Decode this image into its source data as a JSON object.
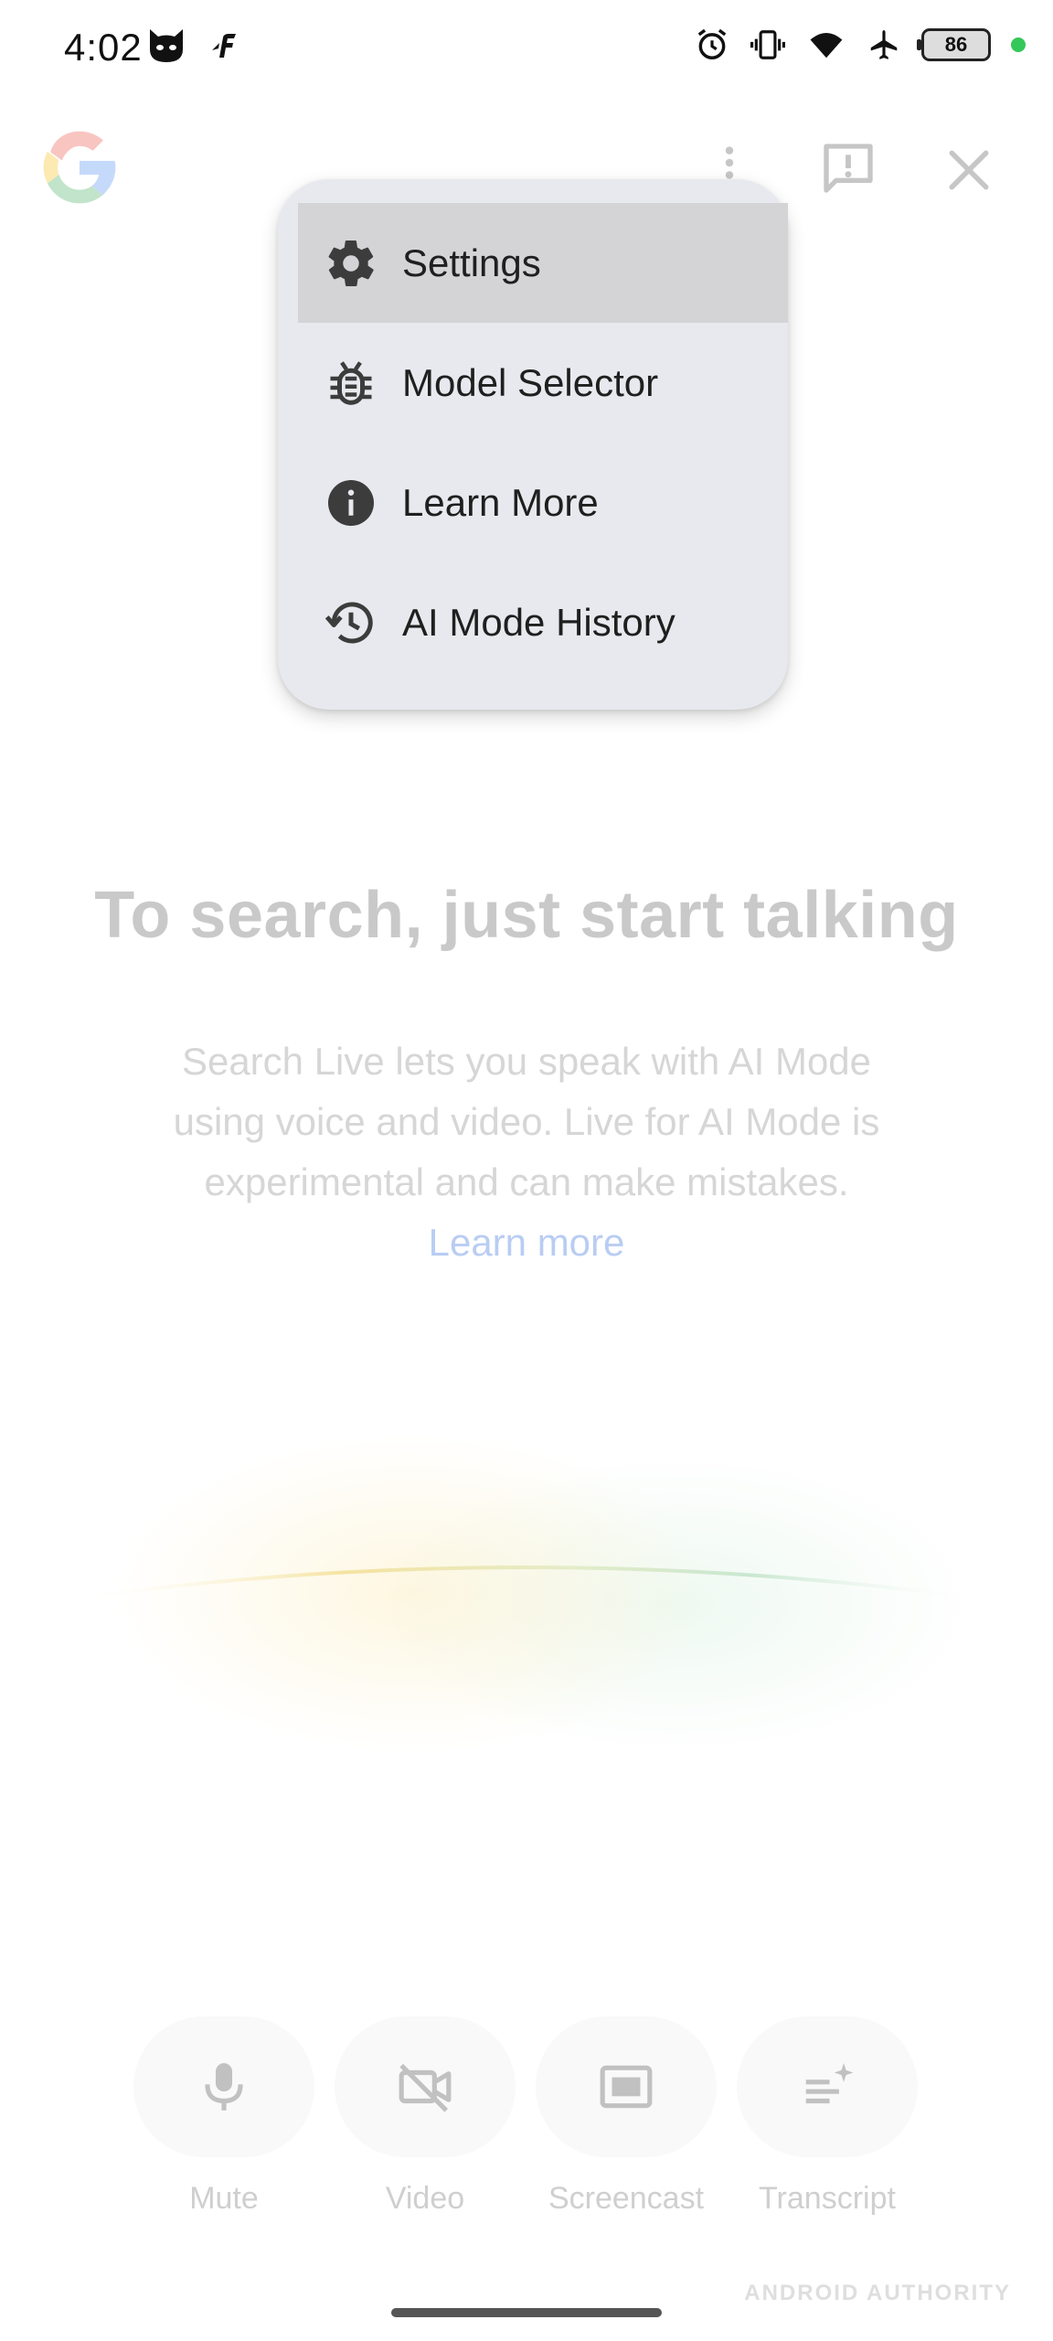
{
  "status_bar": {
    "time": "4:02",
    "battery_level": "86",
    "left_icons": [
      "cat-app-icon",
      "app-f-icon"
    ],
    "right_icons": [
      "alarm-icon",
      "vibrate-icon",
      "wifi-icon",
      "airplane-mode-icon",
      "battery-icon"
    ]
  },
  "header": {
    "icons": [
      "google-logo",
      "more-vert-icon",
      "feedback-icon",
      "close-icon"
    ]
  },
  "menu": {
    "items": [
      {
        "label": "Settings",
        "icon": "gear-icon",
        "selected": true
      },
      {
        "label": "Model Selector",
        "icon": "bug-icon",
        "selected": false
      },
      {
        "label": "Learn More",
        "icon": "info-icon",
        "selected": false
      },
      {
        "label": "AI Mode History",
        "icon": "history-icon",
        "selected": false
      }
    ]
  },
  "main": {
    "title": "To search, just start talking",
    "description": "Search Live lets you speak with AI Mode using voice and video. Live for AI Mode is experimental and can make mistakes.",
    "learn_more": "Learn more"
  },
  "controls": [
    {
      "label": "Mute",
      "icon": "mic-icon"
    },
    {
      "label": "Video",
      "icon": "video-off-icon"
    },
    {
      "label": "Screencast",
      "icon": "screencast-icon"
    },
    {
      "label": "Transcript",
      "icon": "transcript-icon"
    }
  ],
  "watermark": "ANDROID AUTHORITY",
  "colors": {
    "menu_background": "#e8e9ee",
    "menu_selected": "#d4d4d7",
    "link": "#b9cdf3",
    "privacy_dot": "#34c759"
  }
}
